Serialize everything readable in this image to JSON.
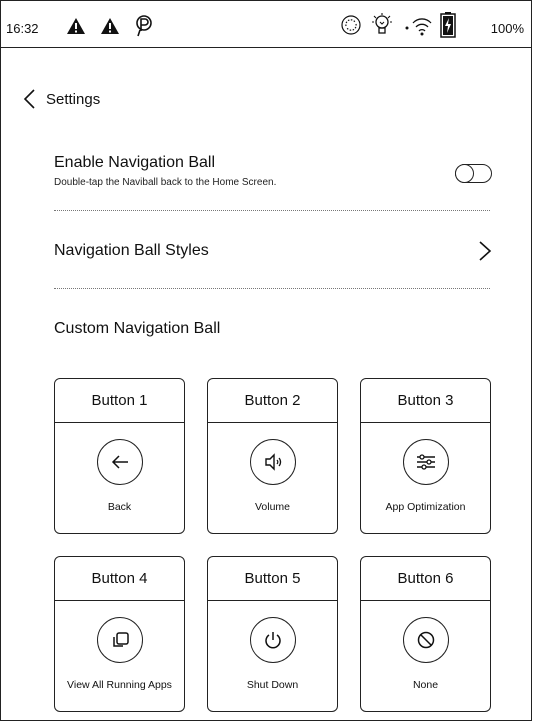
{
  "status_bar": {
    "time": "16:32",
    "battery_percent": "100%",
    "icons": [
      "warning-icon",
      "warning-icon",
      "parking-icon",
      "sync-icon",
      "bulb-icon",
      "wifi-icon",
      "battery-charging-icon"
    ]
  },
  "header": {
    "back_label": "Settings"
  },
  "settings": {
    "enable_nav_ball": {
      "title": "Enable Navigation Ball",
      "subtitle": "Double-tap the Naviball back to the Home Screen.",
      "enabled": false
    },
    "nav_ball_styles": {
      "title": "Navigation Ball Styles"
    },
    "custom_nav_ball": {
      "title": "Custom Navigation Ball"
    }
  },
  "buttons": [
    {
      "header": "Button 1",
      "label": "Back",
      "icon": "arrow-left-icon"
    },
    {
      "header": "Button 2",
      "label": "Volume",
      "icon": "volume-icon"
    },
    {
      "header": "Button 3",
      "label": "App Optimization",
      "icon": "sliders-icon"
    },
    {
      "header": "Button 4",
      "label": "View All Running Apps",
      "icon": "recent-apps-icon"
    },
    {
      "header": "Button 5",
      "label": "Shut Down",
      "icon": "power-icon"
    },
    {
      "header": "Button 6",
      "label": "None",
      "icon": "none-icon"
    }
  ]
}
